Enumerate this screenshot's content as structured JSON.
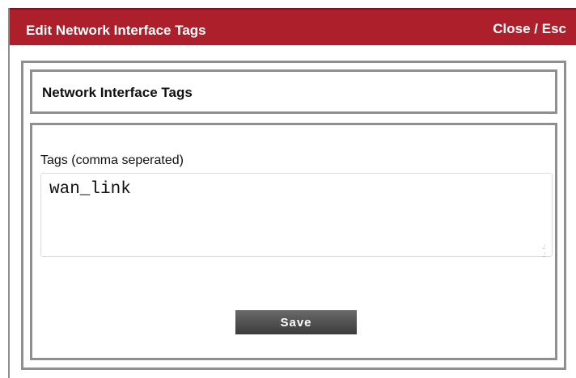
{
  "dialog": {
    "title": "Edit Network Interface Tags",
    "close_label": "Close / Esc",
    "section_title": "Network Interface Tags",
    "form": {
      "tags_label": "Tags (comma seperated)",
      "tags_value": "wan_link",
      "save_label": "Save"
    }
  },
  "colors": {
    "titlebar_bg": "#ac1f2b",
    "panel_border": "#8f8f8f",
    "button_bg": "#4a4a4a"
  }
}
